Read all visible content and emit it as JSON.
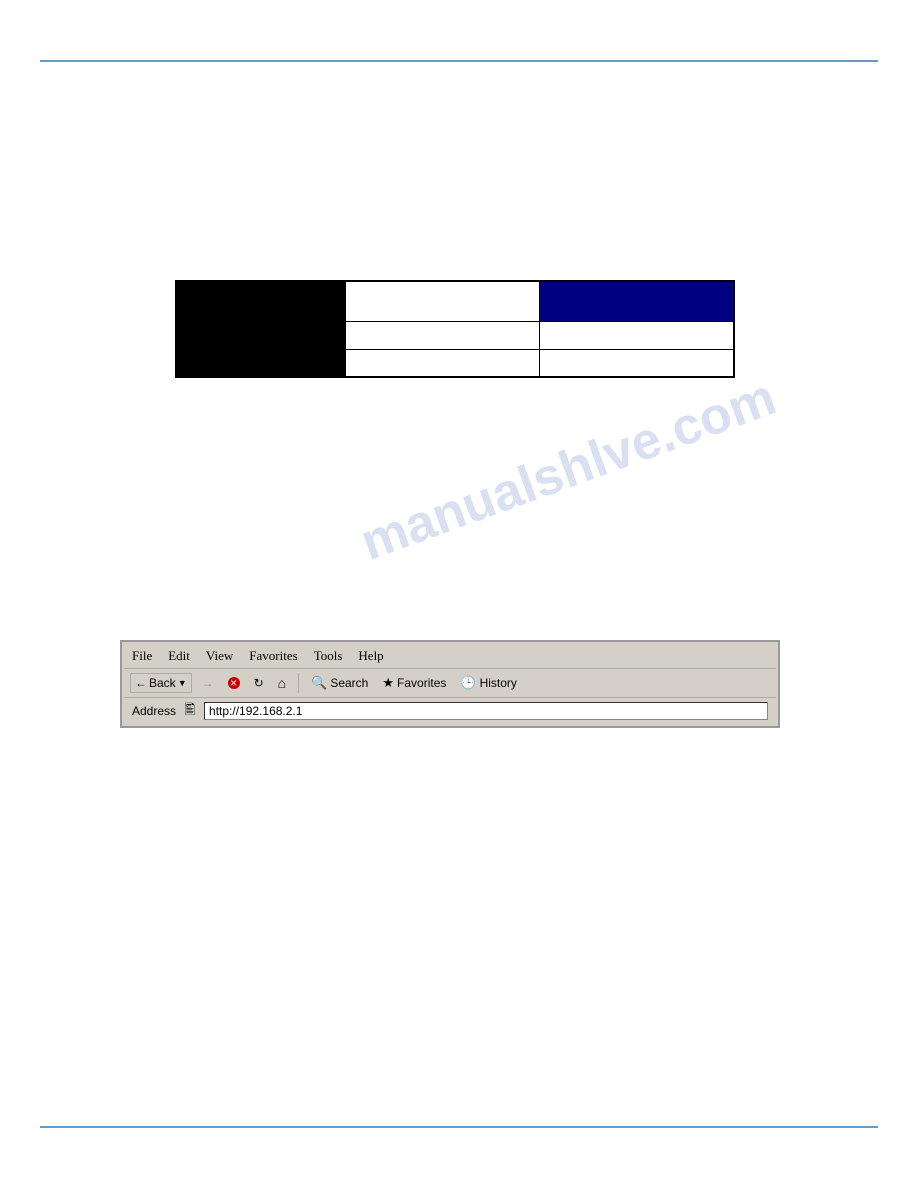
{
  "page": {
    "background": "#ffffff"
  },
  "table": {
    "rows": [
      {
        "col1_type": "black",
        "col2_type": "white",
        "col3_type": "blue"
      },
      {
        "col1_type": "black",
        "col2_type": "white",
        "col3_type": "white"
      },
      {
        "col1_type": "black",
        "col2_type": "white",
        "col3_type": "white"
      }
    ]
  },
  "browser": {
    "menu": {
      "items": [
        "File",
        "Edit",
        "View",
        "Favorites",
        "Tools",
        "Help"
      ]
    },
    "toolbar": {
      "back_label": "Back",
      "search_label": "Search",
      "favorites_label": "Favorites",
      "history_label": "History"
    },
    "address": {
      "label": "Address",
      "url": "http://192.168.2.1"
    }
  },
  "watermark": {
    "text": "manualshlve.com"
  }
}
